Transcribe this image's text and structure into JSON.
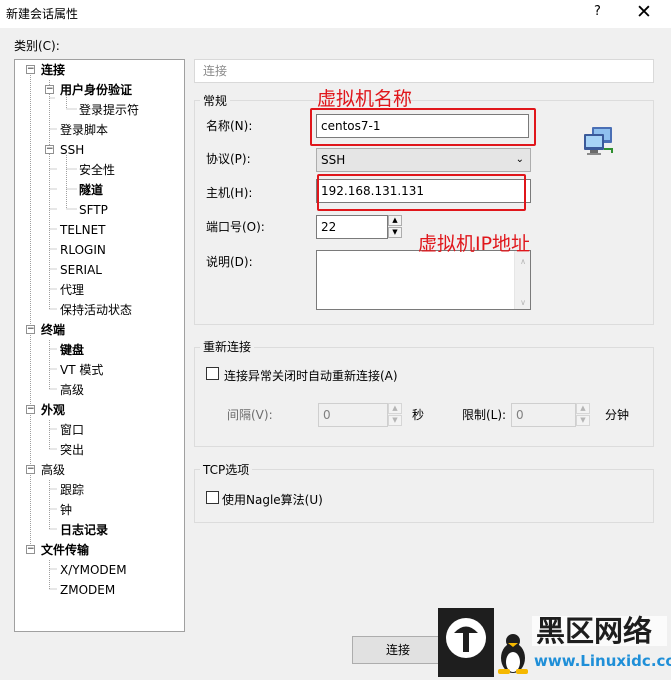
{
  "window": {
    "title": "新建会话属性",
    "help_label": "?",
    "close_label": "✕"
  },
  "category_label": "类别(C):",
  "tree": [
    {
      "label": "连接",
      "bold": true
    },
    {
      "label": "用户身份验证",
      "bold": true
    },
    {
      "label": "登录提示符",
      "bold": false
    },
    {
      "label": "登录脚本",
      "bold": false
    },
    {
      "label": "SSH",
      "bold": false
    },
    {
      "label": "安全性",
      "bold": false
    },
    {
      "label": "隧道",
      "bold": true
    },
    {
      "label": "SFTP",
      "bold": false
    },
    {
      "label": "TELNET",
      "bold": false
    },
    {
      "label": "RLOGIN",
      "bold": false
    },
    {
      "label": "SERIAL",
      "bold": false
    },
    {
      "label": "代理",
      "bold": false
    },
    {
      "label": "保持活动状态",
      "bold": false
    },
    {
      "label": "终端",
      "bold": true
    },
    {
      "label": "键盘",
      "bold": true
    },
    {
      "label": "VT 模式",
      "bold": false
    },
    {
      "label": "高级",
      "bold": false
    },
    {
      "label": "外观",
      "bold": true
    },
    {
      "label": "窗口",
      "bold": false
    },
    {
      "label": "突出",
      "bold": false
    },
    {
      "label": "高级",
      "bold": false
    },
    {
      "label": "跟踪",
      "bold": false
    },
    {
      "label": "钟",
      "bold": false
    },
    {
      "label": "日志记录",
      "bold": true
    },
    {
      "label": "文件传输",
      "bold": true
    },
    {
      "label": "X/YMODEM",
      "bold": false
    },
    {
      "label": "ZMODEM",
      "bold": false
    }
  ],
  "section_header": "连接",
  "general": {
    "title": "常规",
    "name_label": "名称(N):",
    "name_value": "centos7-1",
    "protocol_label": "协议(P):",
    "protocol_value": "SSH",
    "host_label": "主机(H):",
    "host_value": "192.168.131.131",
    "port_label": "端口号(O):",
    "port_value": "22",
    "desc_label": "说明(D):",
    "desc_value": ""
  },
  "reconnect": {
    "title": "重新连接",
    "auto_label": "连接异常关闭时自动重新连接(A)",
    "auto_checked": false,
    "interval_label": "间隔(V):",
    "interval_value": "0",
    "interval_unit": "秒",
    "limit_label": "限制(L):",
    "limit_value": "0",
    "limit_unit": "分钟"
  },
  "tcp": {
    "title": "TCP选项",
    "nagle_label": "使用Nagle算法(U)",
    "nagle_checked": false
  },
  "annotations": {
    "name_note": "虚拟机名称",
    "ip_note": "虚拟机IP地址"
  },
  "connect_button": "连接",
  "watermark": {
    "brand": "黑区网络",
    "site": "www.Linuxidc.com"
  },
  "colors": {
    "annotation": "#e0161b",
    "dialog_bg": "#f0f0f0"
  }
}
